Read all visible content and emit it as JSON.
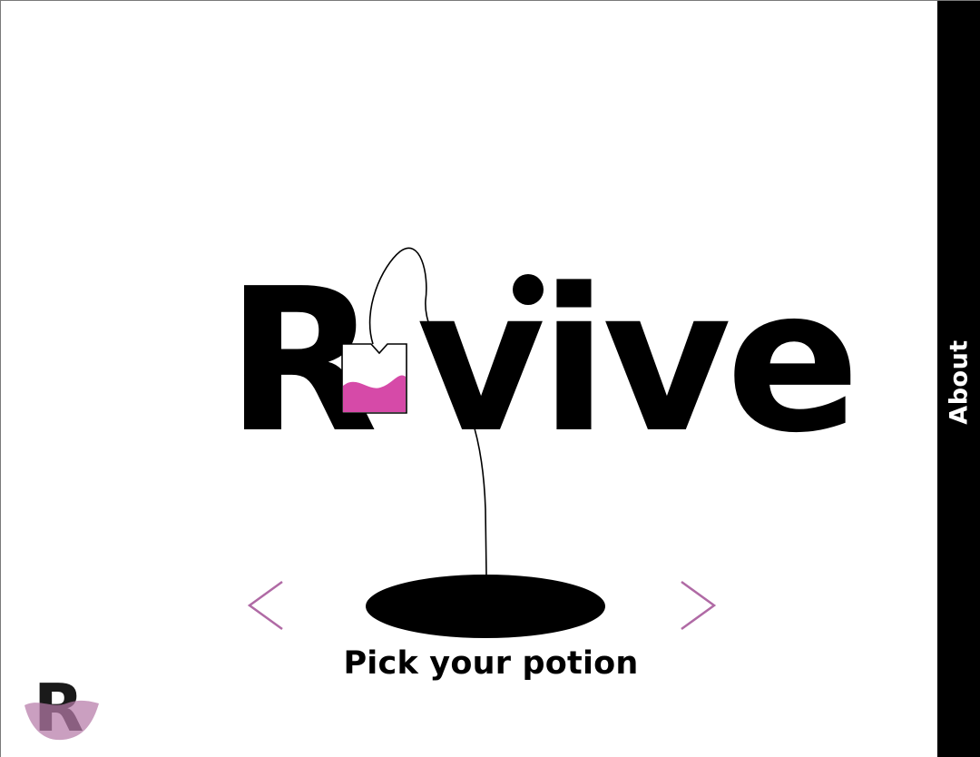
{
  "header": {
    "title_letters": [
      "R",
      "vive"
    ]
  },
  "side_nav": {
    "about_label": "About"
  },
  "carousel": {
    "caption": "Pick your potion"
  },
  "logo": {
    "letter": "R"
  },
  "colors": {
    "accent_magenta": "#D64AA8",
    "arrow_mauve": "#B06AA5",
    "logo_mauve": "#B57AA8",
    "ink": "#000000",
    "side_bar": "#000000"
  },
  "icons": {
    "prev": "chevron-left-icon",
    "next": "chevron-right-icon",
    "teabag": "teabag-icon"
  }
}
